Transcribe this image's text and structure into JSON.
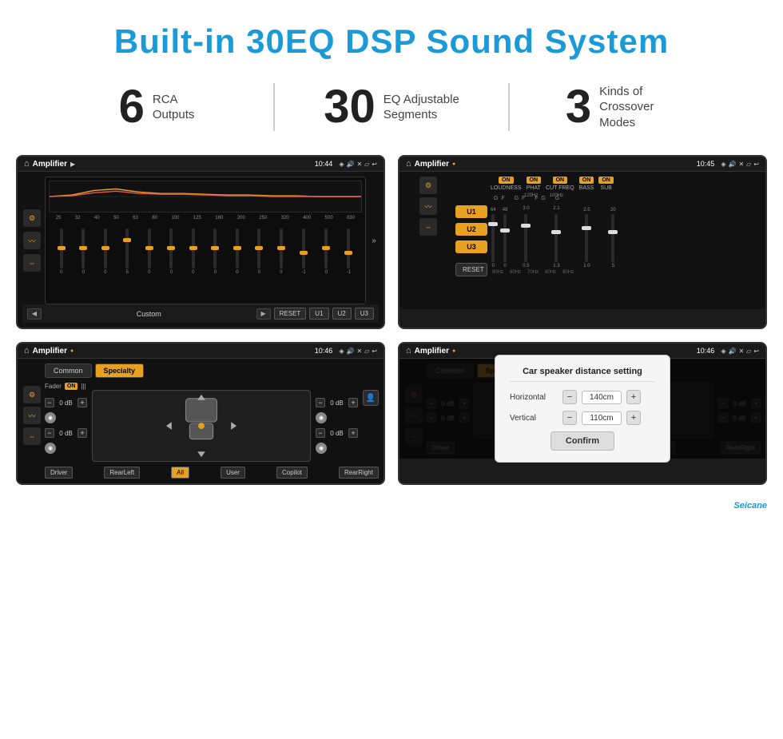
{
  "header": {
    "title": "Built-in 30EQ DSP Sound System"
  },
  "stats": [
    {
      "number": "6",
      "label": "RCA\nOutputs"
    },
    {
      "number": "30",
      "label": "EQ Adjustable\nSegments"
    },
    {
      "number": "3",
      "label": "Kinds of\nCrossover Modes"
    }
  ],
  "screens": {
    "screen1": {
      "statusbar": {
        "title": "Amplifier",
        "time": "10:44"
      },
      "eq_labels": [
        "25",
        "32",
        "40",
        "50",
        "63",
        "80",
        "100",
        "125",
        "160",
        "200",
        "250",
        "320",
        "400",
        "500",
        "630"
      ],
      "eq_values": [
        "0",
        "0",
        "0",
        "5",
        "0",
        "0",
        "0",
        "0",
        "0",
        "0",
        "0",
        "-1",
        "0",
        "-1"
      ],
      "buttons": [
        "Custom",
        "RESET",
        "U1",
        "U2",
        "U3"
      ]
    },
    "screen2": {
      "statusbar": {
        "title": "Amplifier",
        "time": "10:45"
      },
      "u_buttons": [
        "U1",
        "U2",
        "U3"
      ],
      "controls": [
        "LOUDNESS",
        "PHAT",
        "CUT FREQ",
        "BASS",
        "SUB"
      ],
      "reset_btn": "RESET"
    },
    "screen3": {
      "statusbar": {
        "title": "Amplifier",
        "time": "10:46"
      },
      "tabs": [
        "Common",
        "Specialty"
      ],
      "fader_label": "Fader",
      "on_badge": "ON",
      "bottom_btns": [
        "Driver",
        "RearLeft",
        "All",
        "User",
        "Copilot",
        "RearRight"
      ]
    },
    "screen4": {
      "statusbar": {
        "title": "Amplifier",
        "time": "10:46"
      },
      "tabs": [
        "Common",
        "Specialty"
      ],
      "modal": {
        "title": "Car speaker distance setting",
        "horizontal_label": "Horizontal",
        "horizontal_value": "140cm",
        "vertical_label": "Vertical",
        "vertical_value": "110cm",
        "confirm_btn": "Confirm"
      },
      "bottom_btns": [
        "Driver",
        "RearLeft",
        "Copilot",
        "RearRight"
      ]
    }
  },
  "watermark": "Seicane"
}
